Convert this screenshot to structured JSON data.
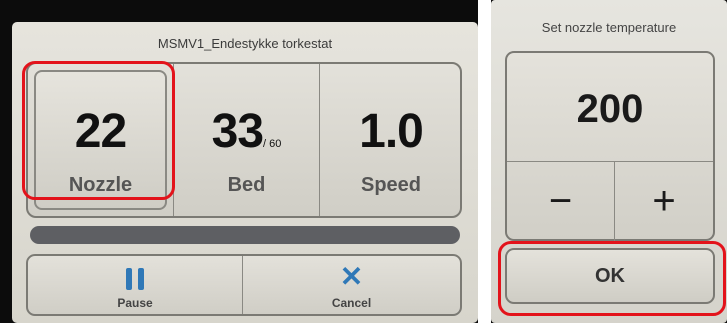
{
  "main_screen": {
    "job_title": "MSMV1_Endestykke torkestat",
    "stats": [
      {
        "value": "22",
        "sub": "",
        "label": "Nozzle"
      },
      {
        "value": "33",
        "sub": "/ 60",
        "label": "Bed"
      },
      {
        "value": "1.0",
        "sub": "",
        "label": "Speed"
      }
    ],
    "progress": {
      "percent": 100
    },
    "actions": {
      "pause_label": "Pause",
      "pause_icon": "pause-icon",
      "cancel_label": "Cancel",
      "cancel_icon": "close-icon"
    }
  },
  "temp_screen": {
    "title": "Set nozzle temperature",
    "value": "200",
    "minus_label": "−",
    "plus_label": "+",
    "ok_label": "OK"
  },
  "colors": {
    "accent_blue": "#2f78b7",
    "progress_track": "#5e5f63",
    "highlight_red": "#e3131b"
  }
}
